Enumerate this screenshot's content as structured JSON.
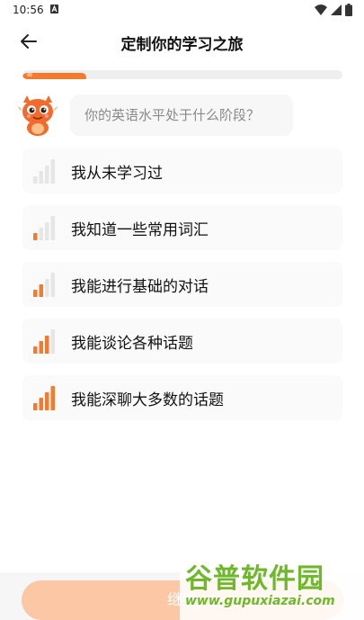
{
  "status_bar": {
    "time": "10:56"
  },
  "header": {
    "title": "定制你的学习之旅"
  },
  "progress": {
    "fraction": 0.2
  },
  "prompt": {
    "question": "你的英语水平处于什么阶段？"
  },
  "options": [
    {
      "label": "我从未学习过",
      "level": 0
    },
    {
      "label": "我知道一些常用词汇",
      "level": 1
    },
    {
      "label": "我能进行基础的对话",
      "level": 2
    },
    {
      "label": "我能谈论各种话题",
      "level": 3
    },
    {
      "label": "我能深聊大多数的话题",
      "level": 4
    }
  ],
  "footer": {
    "continue_label": "继续"
  },
  "watermark": {
    "name": "谷普软件园",
    "url": "www.gupuxiazai.com"
  },
  "colors": {
    "accent": "#f47a2f",
    "inactive_bar": "#e6e6e6",
    "button_disabled": "#fbc7a5",
    "watermark": "#6fb82b"
  }
}
